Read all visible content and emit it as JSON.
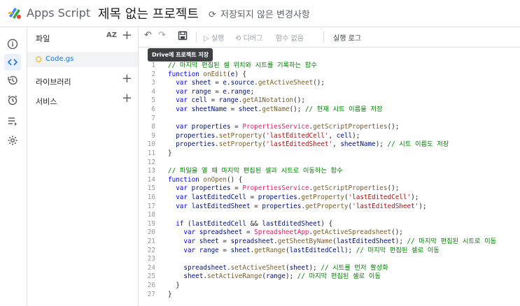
{
  "app": {
    "name": "Apps Script",
    "project_title": "제목 없는 프로젝트",
    "save_status": "저장되지 않은 변경사항"
  },
  "left_rail": {
    "items": [
      {
        "icon": "info-icon",
        "active": false
      },
      {
        "icon": "code-icon",
        "active": true
      },
      {
        "icon": "history-icon",
        "active": false
      },
      {
        "icon": "alarm-icon",
        "active": false
      },
      {
        "icon": "executions-icon",
        "active": false
      },
      {
        "icon": "settings-icon",
        "active": false
      }
    ]
  },
  "sidebar": {
    "files_label": "파일",
    "sort_label": "AZ",
    "files": [
      {
        "name": "Code.gs"
      }
    ],
    "libraries_label": "라이브러리",
    "services_label": "서비스"
  },
  "toolbar": {
    "run": "실행",
    "debug": "디버그",
    "no_functions": "함수 없음",
    "execution_log": "실행 로그",
    "tooltip": "Drive에 프로젝트 저장"
  },
  "editor": {
    "lines": [
      [
        [
          "c-cm",
          "// 마지막 편집된 셀 위치와 시트를 기록하는 함수"
        ]
      ],
      [
        [
          "c-kw",
          "function "
        ],
        [
          "c-fn",
          "onEdit"
        ],
        [
          "c-p",
          "("
        ],
        [
          "c-var",
          "e"
        ],
        [
          "c-p",
          ") {"
        ]
      ],
      [
        [
          "c-kw",
          "  var "
        ],
        [
          "c-var",
          "sheet"
        ],
        [
          "c-p",
          " = "
        ],
        [
          "c-var",
          "e"
        ],
        [
          "c-p",
          "."
        ],
        [
          "c-var",
          "source"
        ],
        [
          "c-p",
          "."
        ],
        [
          "c-fn",
          "getActiveSheet"
        ],
        [
          "c-p",
          "();"
        ]
      ],
      [
        [
          "c-kw",
          "  var "
        ],
        [
          "c-var",
          "range"
        ],
        [
          "c-p",
          " = "
        ],
        [
          "c-var",
          "e"
        ],
        [
          "c-p",
          "."
        ],
        [
          "c-var",
          "range"
        ],
        [
          "c-p",
          ";"
        ]
      ],
      [
        [
          "c-kw",
          "  var "
        ],
        [
          "c-var",
          "cell"
        ],
        [
          "c-p",
          " = "
        ],
        [
          "c-var",
          "range"
        ],
        [
          "c-p",
          "."
        ],
        [
          "c-fn",
          "getA1Notation"
        ],
        [
          "c-p",
          "();"
        ]
      ],
      [
        [
          "c-kw",
          "  var "
        ],
        [
          "c-var",
          "sheetName"
        ],
        [
          "c-p",
          " = "
        ],
        [
          "c-var",
          "sheet"
        ],
        [
          "c-p",
          "."
        ],
        [
          "c-fn",
          "getName"
        ],
        [
          "c-p",
          "(); "
        ],
        [
          "c-cm",
          "// 현재 시트 이름을 저장"
        ]
      ],
      [
        [
          "c-p",
          ""
        ]
      ],
      [
        [
          "c-kw",
          "  var "
        ],
        [
          "c-var",
          "properties"
        ],
        [
          "c-p",
          " = "
        ],
        [
          "c-cls",
          "PropertiesService"
        ],
        [
          "c-p",
          "."
        ],
        [
          "c-fn",
          "getScriptProperties"
        ],
        [
          "c-p",
          "();"
        ]
      ],
      [
        [
          "c-var",
          "  properties"
        ],
        [
          "c-p",
          "."
        ],
        [
          "c-fn",
          "setProperty"
        ],
        [
          "c-p",
          "("
        ],
        [
          "c-str",
          "'lastEditedCell'"
        ],
        [
          "c-p",
          ", "
        ],
        [
          "c-var",
          "cell"
        ],
        [
          "c-p",
          ");"
        ]
      ],
      [
        [
          "c-var",
          "  properties"
        ],
        [
          "c-p",
          "."
        ],
        [
          "c-fn",
          "setProperty"
        ],
        [
          "c-p",
          "("
        ],
        [
          "c-str",
          "'lastEditedSheet'"
        ],
        [
          "c-p",
          ", "
        ],
        [
          "c-var",
          "sheetName"
        ],
        [
          "c-p",
          "); "
        ],
        [
          "c-cm",
          "// 시트 이름도 저장"
        ]
      ],
      [
        [
          "c-p",
          "}"
        ]
      ],
      [
        [
          "c-p",
          ""
        ]
      ],
      [
        [
          "c-cm",
          "// 파일을 열 때 마지막 편집된 셀과 시트로 이동하는 함수"
        ]
      ],
      [
        [
          "c-kw",
          "function "
        ],
        [
          "c-fn",
          "onOpen"
        ],
        [
          "c-p",
          "() {"
        ]
      ],
      [
        [
          "c-kw",
          "  var "
        ],
        [
          "c-var",
          "properties"
        ],
        [
          "c-p",
          " = "
        ],
        [
          "c-cls",
          "PropertiesService"
        ],
        [
          "c-p",
          "."
        ],
        [
          "c-fn",
          "getScriptProperties"
        ],
        [
          "c-p",
          "();"
        ]
      ],
      [
        [
          "c-kw",
          "  var "
        ],
        [
          "c-var",
          "lastEditedCell"
        ],
        [
          "c-p",
          " = "
        ],
        [
          "c-var",
          "properties"
        ],
        [
          "c-p",
          "."
        ],
        [
          "c-fn",
          "getProperty"
        ],
        [
          "c-p",
          "("
        ],
        [
          "c-str",
          "'lastEditedCell'"
        ],
        [
          "c-p",
          ");"
        ]
      ],
      [
        [
          "c-kw",
          "  var "
        ],
        [
          "c-var",
          "lastEditedSheet"
        ],
        [
          "c-p",
          " = "
        ],
        [
          "c-var",
          "properties"
        ],
        [
          "c-p",
          "."
        ],
        [
          "c-fn",
          "getProperty"
        ],
        [
          "c-p",
          "("
        ],
        [
          "c-str",
          "'lastEditedSheet'"
        ],
        [
          "c-p",
          ");"
        ]
      ],
      [
        [
          "c-p",
          ""
        ]
      ],
      [
        [
          "c-kw",
          "  if "
        ],
        [
          "c-p",
          "("
        ],
        [
          "c-var",
          "lastEditedCell"
        ],
        [
          "c-p",
          " && "
        ],
        [
          "c-var",
          "lastEditedSheet"
        ],
        [
          "c-p",
          ") {"
        ]
      ],
      [
        [
          "c-kw",
          "    var "
        ],
        [
          "c-var",
          "spreadsheet"
        ],
        [
          "c-p",
          " = "
        ],
        [
          "c-cls",
          "SpreadsheetApp"
        ],
        [
          "c-p",
          "."
        ],
        [
          "c-fn",
          "getActiveSpreadsheet"
        ],
        [
          "c-p",
          "();"
        ]
      ],
      [
        [
          "c-kw",
          "    var "
        ],
        [
          "c-var",
          "sheet"
        ],
        [
          "c-p",
          " = "
        ],
        [
          "c-var",
          "spreadsheet"
        ],
        [
          "c-p",
          "."
        ],
        [
          "c-fn",
          "getSheetByName"
        ],
        [
          "c-p",
          "("
        ],
        [
          "c-var",
          "lastEditedSheet"
        ],
        [
          "c-p",
          "); "
        ],
        [
          "c-cm",
          "// 마지막 편집된 시트로 이동"
        ]
      ],
      [
        [
          "c-kw",
          "    var "
        ],
        [
          "c-var",
          "range"
        ],
        [
          "c-p",
          " = "
        ],
        [
          "c-var",
          "sheet"
        ],
        [
          "c-p",
          "."
        ],
        [
          "c-fn",
          "getRange"
        ],
        [
          "c-p",
          "("
        ],
        [
          "c-var",
          "lastEditedCell"
        ],
        [
          "c-p",
          "); "
        ],
        [
          "c-cm",
          "// 마지막 편집된 셀로 이동"
        ]
      ],
      [
        [
          "c-p",
          ""
        ]
      ],
      [
        [
          "c-var",
          "    spreadsheet"
        ],
        [
          "c-p",
          "."
        ],
        [
          "c-fn",
          "setActiveSheet"
        ],
        [
          "c-p",
          "("
        ],
        [
          "c-var",
          "sheet"
        ],
        [
          "c-p",
          "); "
        ],
        [
          "c-cm",
          "// 시트를 먼저 활성화"
        ]
      ],
      [
        [
          "c-var",
          "    sheet"
        ],
        [
          "c-p",
          "."
        ],
        [
          "c-fn",
          "setActiveRange"
        ],
        [
          "c-p",
          "("
        ],
        [
          "c-var",
          "range"
        ],
        [
          "c-p",
          "); "
        ],
        [
          "c-cm",
          "// 마지막 편집된 셀로 이동"
        ]
      ],
      [
        [
          "c-p",
          "  }"
        ]
      ],
      [
        [
          "c-p",
          "}"
        ]
      ]
    ]
  },
  "colors": {
    "accent": "#1a73e8",
    "comment": "#008000",
    "keyword": "#0000ff",
    "string": "#a31515"
  }
}
